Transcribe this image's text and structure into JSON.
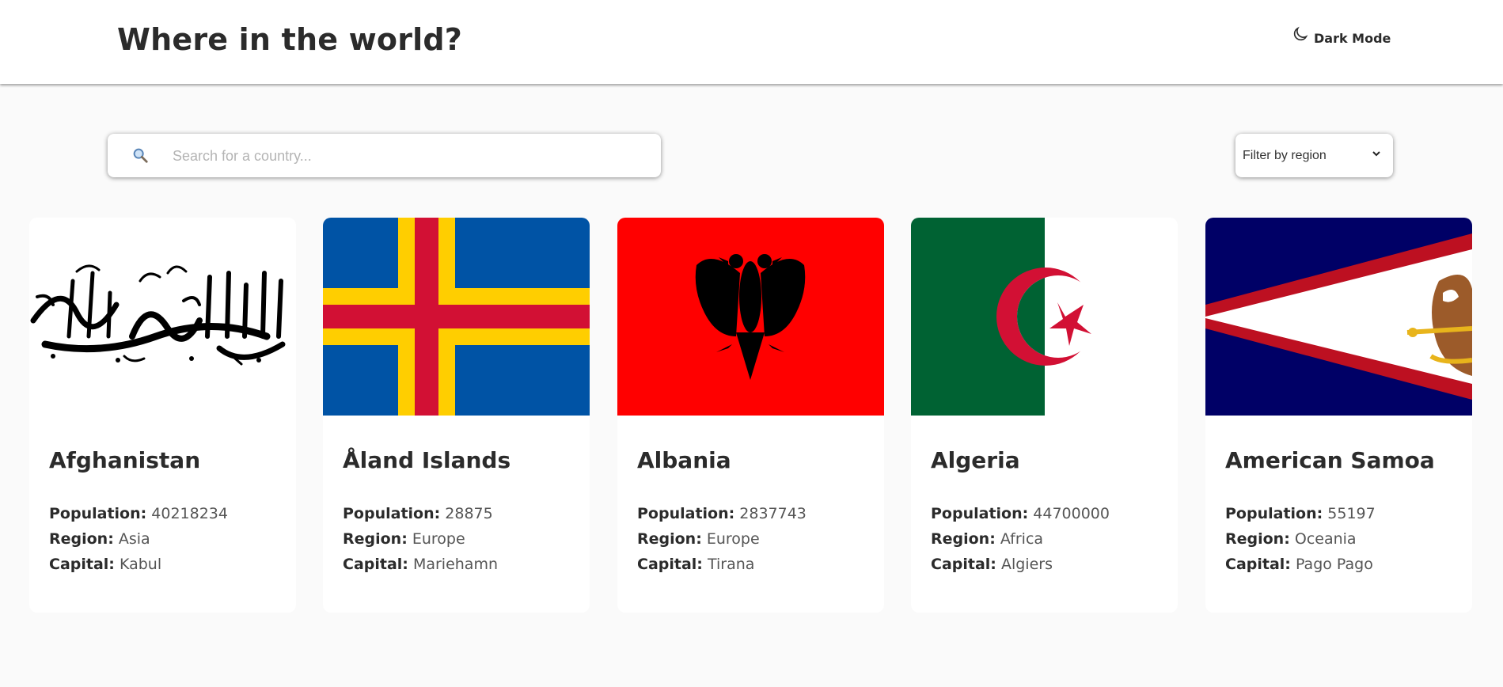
{
  "header": {
    "title": "Where in the world?",
    "dark_mode_label": "Dark Mode",
    "dark_mode_icon": "moon-icon"
  },
  "search": {
    "icon": "search-icon",
    "placeholder": "Search for a country...",
    "value": ""
  },
  "filter": {
    "selected": "Filter by region",
    "icon": "chevron-down-icon"
  },
  "labels": {
    "population": "Population:",
    "region": "Region:",
    "capital": "Capital:"
  },
  "countries": [
    {
      "name": "Afghanistan",
      "population": "40218234",
      "region": "Asia",
      "capital": "Kabul",
      "flag": "afghanistan-flag"
    },
    {
      "name": "Åland Islands",
      "population": "28875",
      "region": "Europe",
      "capital": "Mariehamn",
      "flag": "aland-islands-flag"
    },
    {
      "name": "Albania",
      "population": "2837743",
      "region": "Europe",
      "capital": "Tirana",
      "flag": "albania-flag"
    },
    {
      "name": "Algeria",
      "population": "44700000",
      "region": "Africa",
      "capital": "Algiers",
      "flag": "algeria-flag"
    },
    {
      "name": "American Samoa",
      "population": "55197",
      "region": "Oceania",
      "capital": "Pago Pago",
      "flag": "american-samoa-flag"
    }
  ]
}
